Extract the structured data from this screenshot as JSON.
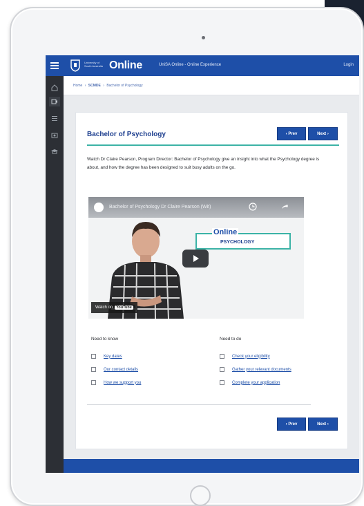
{
  "header": {
    "university": "University of South Australia",
    "brand": "Online",
    "subtitle": "UniSA Online - Online Experience",
    "login": "Login"
  },
  "breadcrumb": [
    "Home",
    "SCMDE",
    "Bachelor of Psychology"
  ],
  "page": {
    "title": "Bachelor of Psychology",
    "prev_label": "‹ Prev",
    "next_label": "Next ›",
    "intro": "Watch Dr Claire Pearson, Program Director: Bachelor of Psychology give an insight into what the Psychology degree is about, and how the degree has been designed to suit busy adults on the go."
  },
  "video": {
    "title": "Bachelor of Psychology Dr Claire Pearson (Wit)",
    "brand_online": "Online",
    "brand_program": "PSYCHOLOGY",
    "watch_on": "Watch on",
    "youtube": "YouTube"
  },
  "need_to_know": {
    "heading": "Need to know",
    "items": [
      "Key dates",
      "Our contact details",
      "How we support you"
    ]
  },
  "need_to_do": {
    "heading": "Need to do",
    "items": [
      "Check your eligibility",
      "Gather your relevant documents",
      "Complete your application"
    ]
  },
  "colors": {
    "brand_blue": "#1e4fa8",
    "teal_accent": "#3bb3a6",
    "rail_dark": "#2c2f35"
  },
  "icons": [
    "menu-icon",
    "home-icon",
    "video-icon",
    "list-icon",
    "camera-icon",
    "graduation-icon",
    "clock-icon",
    "share-icon",
    "play-icon"
  ]
}
